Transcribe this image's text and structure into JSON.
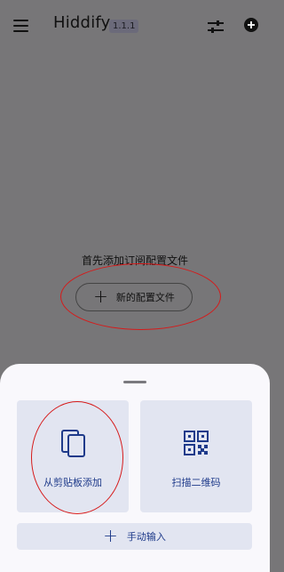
{
  "appbar": {
    "title": "Hiddify",
    "version": "1.1.1"
  },
  "empty_state": {
    "hint": "首先添加订阅配置文件",
    "new_profile_label": "新的配置文件",
    "new_profile_icon": "plus-icon"
  },
  "sheet": {
    "clipboard_label": "从剪贴板添加",
    "clipboard_icon": "clipboard-icon",
    "scan_label": "扫描二维码",
    "scan_icon": "qr-code-icon",
    "manual_label": "手动输入",
    "manual_icon": "plus-icon"
  },
  "colors": {
    "scrim": "#777678",
    "sheet_bg": "#f9f8fc",
    "tile_bg": "#e2e5f1",
    "accent": "#1e3a8a",
    "annotation": "#d61a1a"
  }
}
